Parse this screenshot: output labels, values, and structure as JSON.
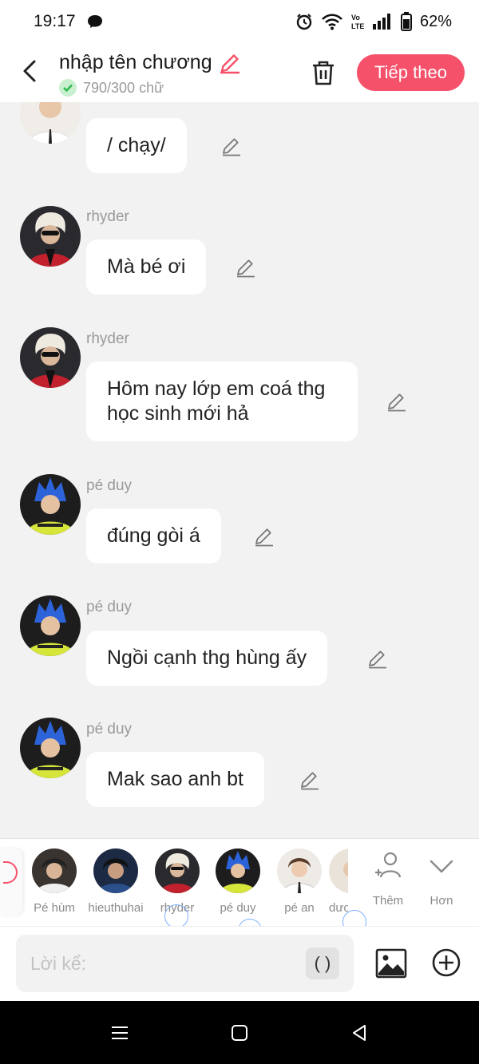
{
  "status": {
    "time": "19:17",
    "battery": "62%"
  },
  "header": {
    "title": "nhập tên chương",
    "word_count": "790/300 chữ",
    "next_label": "Tiếp theo",
    "accent": "#f6516a"
  },
  "messages": [
    {
      "sender": "",
      "text": "/ chạy/",
      "avatar": "pe-an"
    },
    {
      "sender": "rhyder",
      "text": "Mà bé ơi",
      "avatar": "rhyder"
    },
    {
      "sender": "rhyder",
      "text": "Hôm nay lớp em coá thg học sinh mới hả",
      "avatar": "rhyder"
    },
    {
      "sender": "pé duy",
      "text": "đúng gòi á",
      "avatar": "pe-duy"
    },
    {
      "sender": "pé duy",
      "text": "Ngồi cạnh thg hùng ấy",
      "avatar": "pe-duy"
    },
    {
      "sender": "pé duy",
      "text": "Mak sao anh bt",
      "avatar": "pe-duy"
    }
  ],
  "characters": [
    {
      "name": "Pé hùm"
    },
    {
      "name": "hieuthuhai"
    },
    {
      "name": "rhyder"
    },
    {
      "name": "pé duy"
    },
    {
      "name": "pé an"
    },
    {
      "name": "dươ"
    }
  ],
  "actions": {
    "add_label": "Thêm",
    "more_label": "Hơn"
  },
  "input": {
    "placeholder": "Lời kể:",
    "paren_label": "( )"
  }
}
